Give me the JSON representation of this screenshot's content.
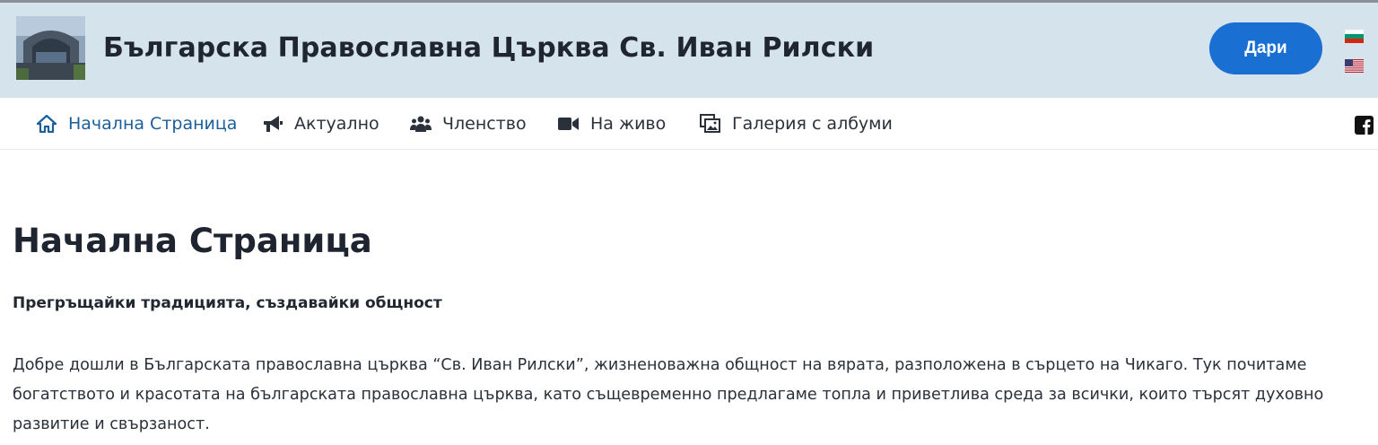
{
  "header": {
    "site_title": "Българска Православна Църква Св. Иван Рилски",
    "donate_label": "Дари",
    "logo_icon": "church-photo-icon",
    "languages": [
      "bg-flag-icon",
      "us-flag-icon"
    ]
  },
  "nav": {
    "items": [
      {
        "label": "Начална Страница",
        "icon": "home-icon",
        "active": true
      },
      {
        "label": "Актуално",
        "icon": "megaphone-icon"
      },
      {
        "label": "Членство",
        "icon": "users-icon"
      },
      {
        "label": "На живо",
        "icon": "video-camera-icon"
      },
      {
        "label": "Галерия с албуми",
        "icon": "photo-gallery-icon"
      }
    ],
    "social_icon": "facebook-icon"
  },
  "main": {
    "title": "Начална Страница",
    "subtitle": "Прегръщайки традицията, създавайки общност",
    "intro": "Добре дошли в Българската православна църква “Св. Иван Рилски”, жизненоважна общност на вярата, разположена в сърцето на Чикаго. Тук почитаме богатството и красотата на българската православна църква, като същевременно предлагаме топла и приветлива среда за всички, които търсят духовно развитие и свързаност."
  },
  "colors": {
    "header_bg": "#d4e3ec",
    "accent": "#1a6fd3",
    "active_nav": "#1b5e9c"
  }
}
